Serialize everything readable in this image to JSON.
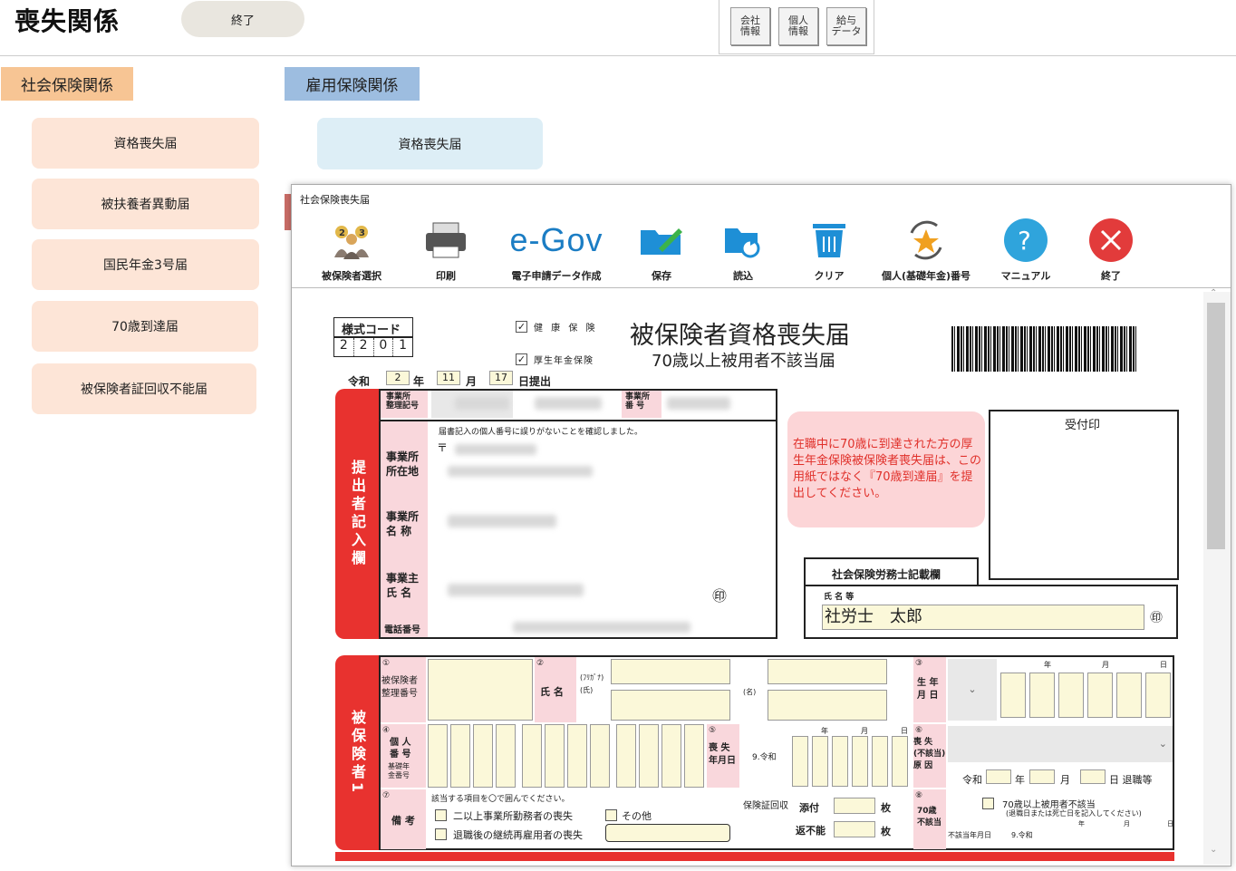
{
  "header": {
    "title": "喪失関係",
    "end_label": "終了",
    "top_buttons": [
      {
        "label": "会社\n情報"
      },
      {
        "label": "個人\n情報"
      },
      {
        "label": "給与\nデータ"
      }
    ]
  },
  "sections": {
    "social": "社会保険関係",
    "employment": "雇用保険関係"
  },
  "social_buttons": [
    "資格喪失届",
    "被扶養者異動届",
    "国民年金3号届",
    "70歳到達届",
    "被保険者証回収不能届"
  ],
  "employment_buttons": [
    "資格喪失届"
  ],
  "window": {
    "title": "社会保険喪失届",
    "toolbar": [
      "被保険者選択",
      "印刷",
      "電子申請データ作成",
      "保存",
      "読込",
      "クリア",
      "個人(基礎年金)番号",
      "マニュアル",
      "終了"
    ],
    "egov_text": "e-Gov"
  },
  "form": {
    "style_code_label": "様式コード",
    "style_code": [
      "2",
      "2",
      "0",
      "1"
    ],
    "health_insurance": "健 康 保 険",
    "pension_insurance": "厚生年金保険",
    "title": "被保険者資格喪失届",
    "subtitle": "70歳以上被用者不該当届",
    "era": "令和",
    "year": "2",
    "year_unit": "年",
    "month": "11",
    "month_unit": "月",
    "day": "17",
    "submit": "日提出",
    "office_code_label": "事業所\n整理記号",
    "office_no_label": "事業所\n番 号",
    "confirm_note": "届書記入の個人番号に誤りがないことを確認しました。",
    "postal_mark": "〒",
    "office_addr_label": "事業所\n所在地",
    "office_name_label": "事業所\n名 称",
    "owner_label": "事業主\n氏 名",
    "phone_label": "電話番号",
    "seal": "㊞",
    "submitter_side": "提出者記入欄",
    "notice": "在職中に70歳に到達された方の厚生年金保険被保険者喪失届は、この用紙ではなく『70歳到達届』を提出してください。",
    "receipt_label": "受付印",
    "sharoushi_label": "社会保険労務士記載欄",
    "name_etc": "氏 名 等",
    "sharoushi_name": "社労士　太郎",
    "insured_side": "被保険者1",
    "insured_no_label": "被保険者\n整理番号",
    "name_label": "氏 名",
    "furigana": "(ﾌﾘｶﾞﾅ)",
    "shi": "(氏)",
    "mei": "(名)",
    "birth_label": "生 年\n月 日",
    "year_lbl": "年",
    "month_lbl": "月",
    "day_lbl": "日",
    "my_number_label": "個 人\n番 号",
    "basic_pension": "基礎年\n金番号",
    "loss_date_label": "喪 失\n年月日",
    "reiwa9": "9.令和",
    "loss_reason_label": "喪 失\n(不該当)\n原 因",
    "reason_reiwa": "令和",
    "retire": "日 退職等",
    "notes_label": "備 考",
    "notes_instr": "該当する項目を〇で囲んでください。",
    "opt1": "二以上事業所勤務者の喪失",
    "opt2": "退職後の継続再雇用者の喪失",
    "opt3": "その他",
    "card_collect": "保険証回収",
    "attached": "添付",
    "unreturnable": "返不能",
    "sheets": "枚",
    "over70": "70歳\n不該当",
    "over70_check": "70歳以上被用者不該当",
    "over70_note": "(退職日または死亡日を記入してください)",
    "nonapp_date": "不該当年月日",
    "circ": [
      "①",
      "②",
      "③",
      "④",
      "⑤",
      "⑥",
      "⑦",
      "⑧"
    ]
  }
}
